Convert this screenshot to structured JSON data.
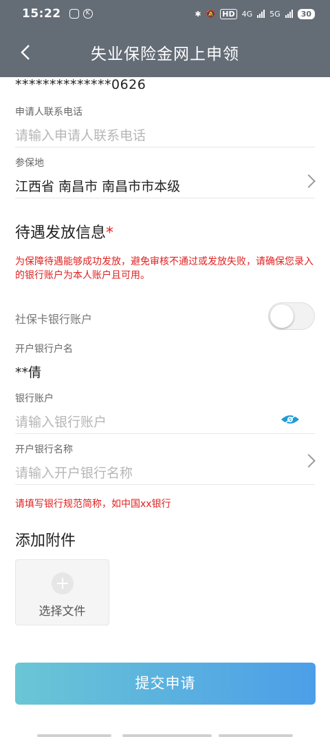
{
  "status_bar": {
    "time": "15:22",
    "hd": "HD",
    "network_4g": "4G",
    "network_5g": "5G",
    "battery": "30"
  },
  "header": {
    "title": "失业保险金网上申领"
  },
  "masked_id": "**************0626",
  "phone": {
    "label": "申请人联系电话",
    "placeholder": "请输入申请人联系电话"
  },
  "insured_area": {
    "label": "参保地",
    "value": "江西省 南昌市 南昌市市本级"
  },
  "benefit_section": {
    "title": "待遇发放信息",
    "required_mark": "*",
    "warning": "为保障待遇能够成功发放，避免审核不通过或发放失败，请确保您录入的银行账户为本人账户且可用。"
  },
  "social_card_toggle": {
    "label": "社保卡银行账户",
    "on": false
  },
  "account_name": {
    "label": "开户银行户名",
    "value": "**倩"
  },
  "bank_account": {
    "label": "银行账户",
    "placeholder": "请输入银行账户"
  },
  "bank_name": {
    "label": "开户银行名称",
    "placeholder": "请输入开户银行名称"
  },
  "bank_hint": "请填写银行规范简称，如中国xx银行",
  "attachments": {
    "title": "添加附件",
    "select_label": "选择文件"
  },
  "submit": {
    "label": "提交申请"
  },
  "colors": {
    "header_bg": "#646c76",
    "warning": "#e02020",
    "accent": "#1e9bd7",
    "button_start": "#6ac6d5",
    "button_end": "#4c9ee8"
  }
}
